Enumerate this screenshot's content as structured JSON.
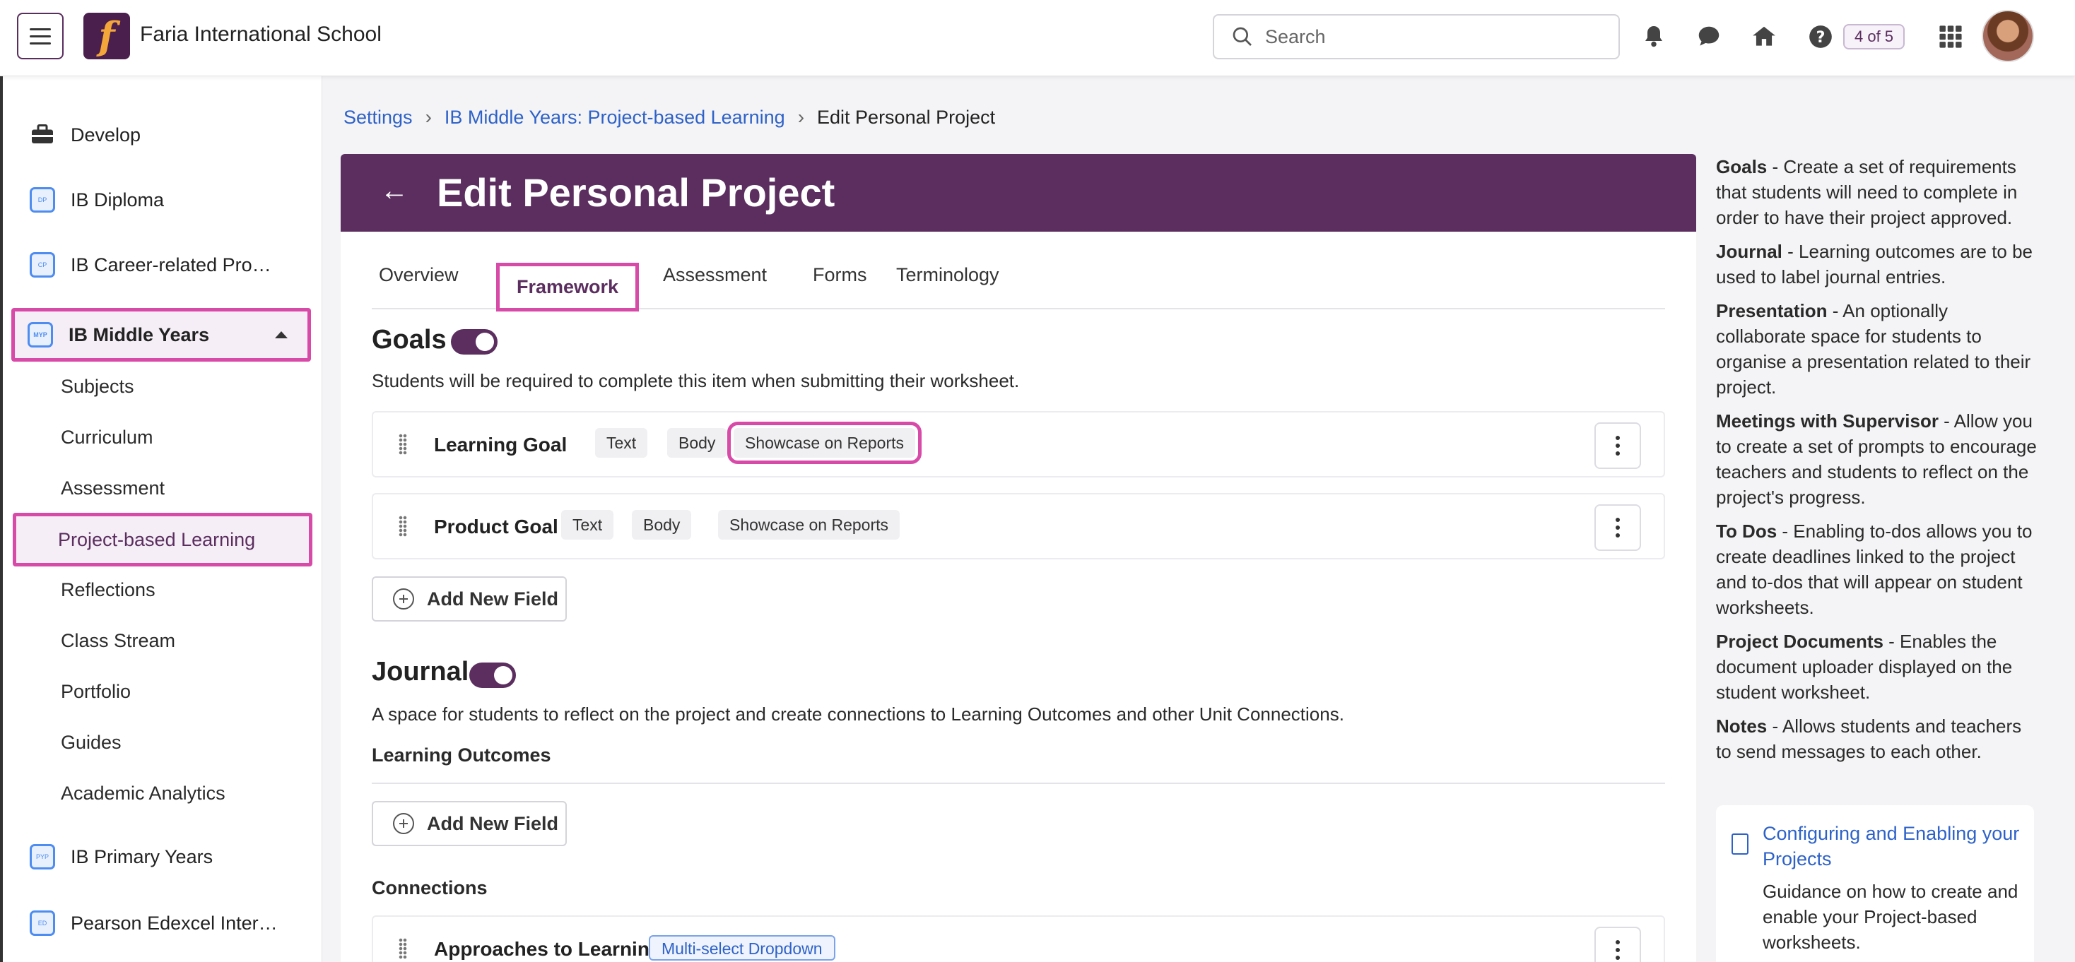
{
  "header": {
    "school_name": "Faria International School",
    "logo_letter": "f",
    "search_placeholder": "Search",
    "progress_badge": "4 of 5",
    "icons": [
      "menu-icon",
      "bell-icon",
      "chat-icon",
      "home-icon",
      "help-icon",
      "apps-grid-icon"
    ]
  },
  "sidebar": {
    "items": [
      {
        "label": "Develop",
        "icon": "briefcase-icon"
      },
      {
        "label": "IB Diploma",
        "icon": "DP"
      },
      {
        "label": "IB Career-related Pro…",
        "icon": "CP"
      },
      {
        "label": "IB Middle Years",
        "icon": "MYP",
        "expanded": true
      },
      {
        "label": "IB Primary Years",
        "icon": "PYP"
      },
      {
        "label": "Pearson Edexcel Inter…",
        "icon": "ED"
      }
    ],
    "subitems": [
      "Subjects",
      "Curriculum",
      "Assessment",
      "Project-based Learning",
      "Reflections",
      "Class Stream",
      "Portfolio",
      "Guides",
      "Academic Analytics"
    ]
  },
  "breadcrumb": {
    "items": [
      "Settings",
      "IB Middle Years: Project-based Learning",
      "Edit Personal Project"
    ]
  },
  "page": {
    "title": "Edit Personal Project",
    "tabs": [
      "Overview",
      "Framework",
      "Assessment",
      "Forms",
      "Terminology"
    ],
    "active_tab": "Framework"
  },
  "goals": {
    "title": "Goals",
    "enabled": true,
    "description": "Students will be required to complete this item when submitting their worksheet.",
    "fields": [
      {
        "name": "Learning Goal",
        "tags": [
          "Text",
          "Body",
          "Showcase on Reports"
        ]
      },
      {
        "name": "Product Goal",
        "tags": [
          "Text",
          "Body",
          "Showcase on Reports"
        ]
      }
    ],
    "add_label": "Add New Field"
  },
  "journal": {
    "title": "Journal",
    "enabled": true,
    "description": "A space for students to reflect on the project and create connections to Learning Outcomes and other Unit Connections.",
    "learning_outcomes_label": "Learning Outcomes",
    "add_label": "Add New Field",
    "connections_label": "Connections",
    "connection_fields": [
      {
        "name": "Approaches to Learning",
        "tag": "Multi-select Dropdown"
      }
    ]
  },
  "help_panel": {
    "entries": [
      {
        "term": "Goals",
        "text": " - Create a set of requirements that students will need to complete in order to have their project approved."
      },
      {
        "term": "Journal",
        "text": " - Learning outcomes are to be used to label journal entries."
      },
      {
        "term": "Presentation",
        "text": " - An optionally collaborate space for students to organise a presentation related to their project."
      },
      {
        "term": "Meetings with Supervisor",
        "text": " - Allow you to create a set of prompts to encourage teachers and students to reflect on the project's progress."
      },
      {
        "term": "To Dos",
        "text": " - Enabling to-dos allows you to create deadlines linked to the project and to-dos that will appear on student worksheets."
      },
      {
        "term": "Project Documents",
        "text": " - Enables the document uploader displayed on the student worksheet."
      },
      {
        "term": "Notes",
        "text": " - Allows students and teachers to send messages to each other."
      }
    ],
    "card_title": "Configuring and Enabling your Projects",
    "card_body": "Guidance on how to create and enable your Project-based worksheets."
  },
  "colors": {
    "brand": "#5b2e5f",
    "highlight": "#d84aa8",
    "link": "#2e62c8"
  }
}
